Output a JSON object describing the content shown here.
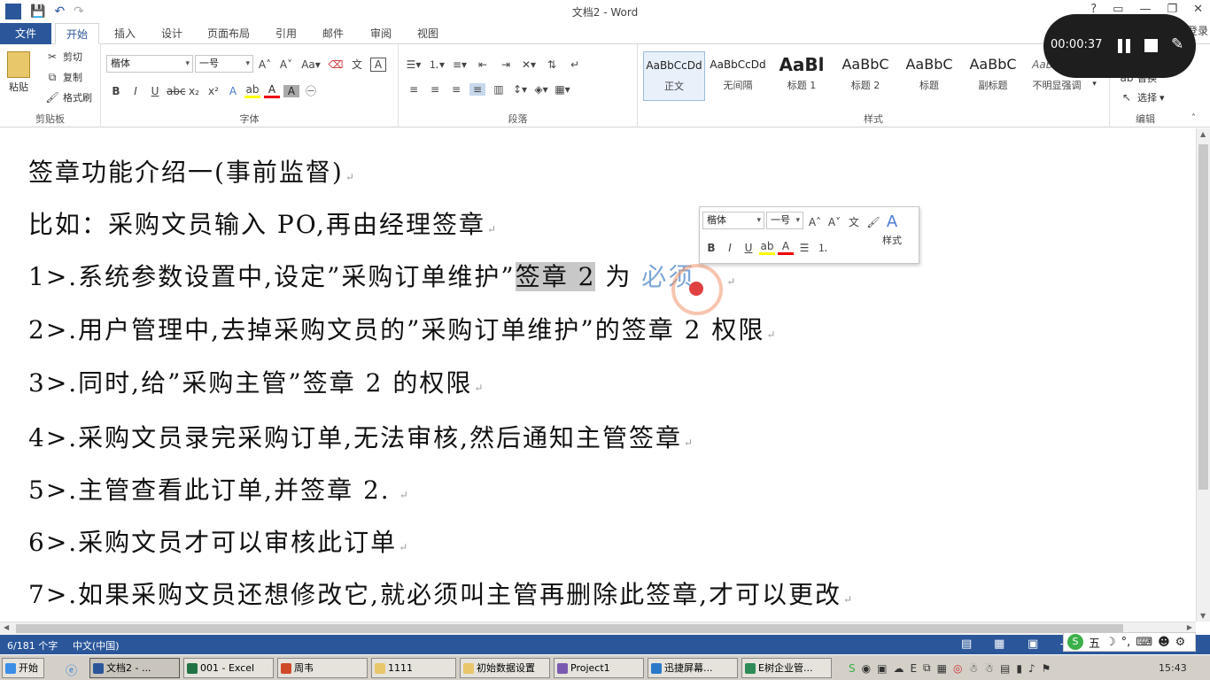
{
  "window": {
    "title": "文档2 - Word",
    "controls": [
      "?",
      "▭",
      "—",
      "❐",
      "✕"
    ]
  },
  "qat": {
    "save": "💾",
    "undo": "↶",
    "redo": "↷"
  },
  "tabs": [
    {
      "label": "文件"
    },
    {
      "label": "开始"
    },
    {
      "label": "插入"
    },
    {
      "label": "设计"
    },
    {
      "label": "页面布局"
    },
    {
      "label": "引用"
    },
    {
      "label": "邮件"
    },
    {
      "label": "审阅"
    },
    {
      "label": "视图"
    }
  ],
  "login": "登录",
  "ribbon": {
    "clipboard": {
      "paste": "粘贴",
      "cut": "剪切",
      "copy": "复制",
      "format_painter": "格式刷",
      "label": "剪贴板"
    },
    "font": {
      "name": "楷体",
      "size": "一号",
      "label": "字体"
    },
    "paragraph": {
      "label": "段落"
    },
    "styles": {
      "label": "样式",
      "items": [
        {
          "sample": "AaBbCcDd",
          "name": "正文"
        },
        {
          "sample": "AaBbCcDd",
          "name": "无间隔"
        },
        {
          "sample": "AaBl",
          "name": "标题 1"
        },
        {
          "sample": "AaBbC",
          "name": "标题 2"
        },
        {
          "sample": "AaBbC",
          "name": "标题"
        },
        {
          "sample": "AaBbC",
          "name": "副标题"
        },
        {
          "sample": "AaBbCcD",
          "name": "不明显强调"
        }
      ]
    },
    "editing": {
      "replace": "替换",
      "select": "选择",
      "label": "编辑"
    }
  },
  "recorder": {
    "time": "00:00:37"
  },
  "minibar": {
    "font": "楷体",
    "size": "一号",
    "styles": "样式"
  },
  "document": {
    "lines": [
      {
        "text": "签章功能介绍一(事前监督)"
      },
      {
        "text": "比如：采购文员输入 PO,再由经理签章"
      },
      {
        "pre": "1>.系统参数设置中,设定”采购订单维护”",
        "sel": "签章 2",
        "mid": " 为 ",
        "post": "必须"
      },
      {
        "text": "2>.用户管理中,去掉采购文员的”采购订单维护”的签章 2 权限"
      },
      {
        "text": "3>.同时,给”采购主管”签章 2 的权限"
      },
      {
        "text": "4>.采购文员录完采购订单,无法审核,然后通知主管签章"
      },
      {
        "text": "5>.主管查看此订单,并签章 2."
      },
      {
        "text": "6>.采购文员才可以审核此订单"
      },
      {
        "text": "7>.如果采购文员还想修改它,就必须叫主管再删除此签章,才可以更改"
      }
    ],
    "para_mark": "↵"
  },
  "status": {
    "words": "6/181 个字",
    "lang": "中文(中国)"
  },
  "taskbar": {
    "start": "开始",
    "items": [
      {
        "label": "文档2 - ..."
      },
      {
        "label": "001 - Excel"
      },
      {
        "label": "周韦"
      },
      {
        "label": "1111"
      },
      {
        "label": "初始数据设置"
      },
      {
        "label": "Project1"
      },
      {
        "label": "迅捷屏幕..."
      },
      {
        "label": "E树企业管..."
      }
    ],
    "clock": "15:43"
  }
}
